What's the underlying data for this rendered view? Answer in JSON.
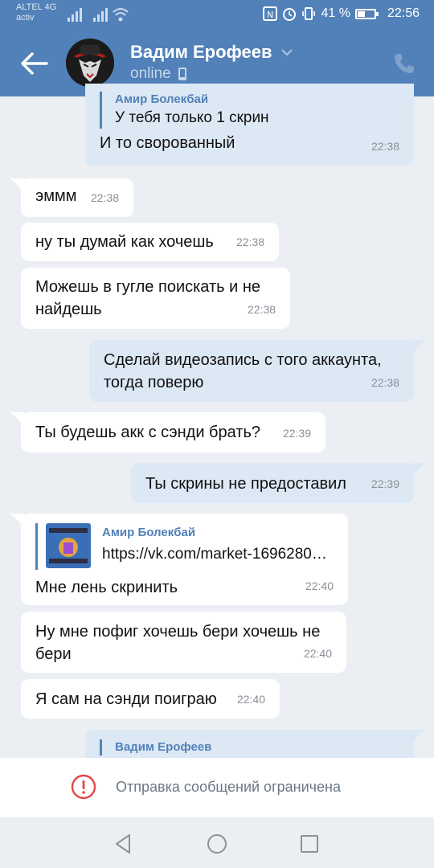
{
  "status_bar": {
    "carrier": "ALTEL 4G",
    "carrier_sub": "activ",
    "battery_percent": "41 %",
    "battery_level": 0.41,
    "time": "22:56"
  },
  "header": {
    "contact_name": "Вадим Ерофеев",
    "status": "online"
  },
  "messages": [
    {
      "dir": "out",
      "reply_text": "У тебя только 1 скрин",
      "reply_author": "Амир Болекбай",
      "text": "И то сворованный",
      "time": "22:38"
    },
    {
      "dir": "in",
      "text": "эммм",
      "time": "22:38"
    },
    {
      "dir": "in",
      "text": "ну ты думай как хочешь",
      "time": "22:38"
    },
    {
      "dir": "in",
      "text_lines": [
        "Можешь в гугле поискать и не",
        "найдешь"
      ],
      "time": "22:38"
    },
    {
      "dir": "out",
      "text_lines": [
        "Сделай видеозапись с того аккаунта,",
        "тогда поверю"
      ],
      "time": "22:38"
    },
    {
      "dir": "in",
      "text": "Ты будешь акк с сэнди брать?",
      "time": "22:39"
    },
    {
      "dir": "out",
      "text": "Ты скрины не предоставил",
      "time": "22:39"
    },
    {
      "dir": "in",
      "reply_author": "Амир Болекбай",
      "reply_text": "https://vk.com/market-1696280…",
      "text": "Мне лень скринить",
      "time": "22:40"
    },
    {
      "dir": "in",
      "text_lines": [
        "Ну мне пофиг хочешь бери хочешь не",
        "бери"
      ],
      "time": "22:40"
    },
    {
      "dir": "in",
      "text": "Я сам на сэнди поиграю",
      "time": "22:40"
    },
    {
      "dir": "out",
      "reply_author": "Вадим Ерофеев"
    }
  ],
  "restriction": {
    "text": "Отправка сообщений ограничена"
  },
  "colors": {
    "header": "#5181b8",
    "background": "#ebeef2",
    "incoming": "#ffffff",
    "outgoing": "#dde8f5",
    "warning": "#e64646"
  }
}
